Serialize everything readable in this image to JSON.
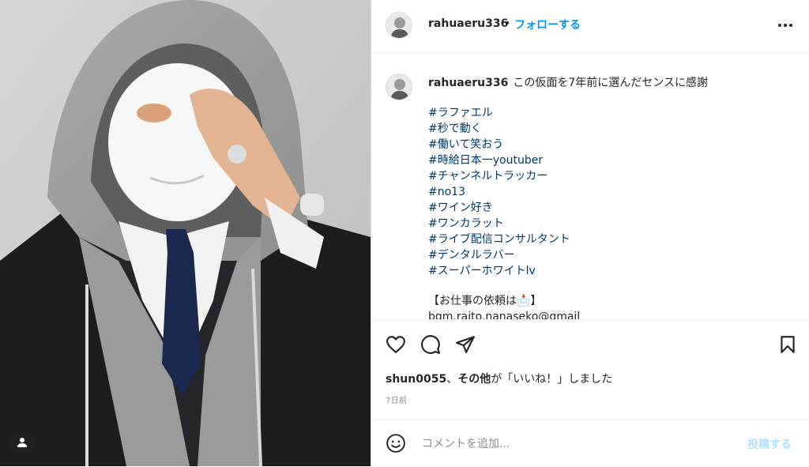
{
  "post": {
    "username": "rahuaeru336",
    "separator": "•",
    "follow_label": "フォローする",
    "more_icon": "more-horizontal-icon",
    "photo_user_tag_icon": "person-icon"
  },
  "caption": {
    "username": "rahuaeru336",
    "text": "この仮面を7年前に選んだセンスに感謝",
    "hashtags": [
      "#ラファエル",
      "#秒で動く",
      "#働いて笑おう",
      "#時給日本一youtuber",
      "#チャンネルトラッカー",
      "#no13",
      "#ワイン好き",
      "#ワンカラット",
      "#ライブ配信コンサルタント",
      "#デンタルラバー",
      "#スーパーホワイトlv"
    ],
    "contact_heading": "【お仕事の依頼は📩】",
    "contact_email": "bgm.raito.nanaseko@gmail"
  },
  "actions": {
    "like_icon": "heart-icon",
    "comment_icon": "comment-icon",
    "share_icon": "share-plane-icon",
    "save_icon": "bookmark-icon"
  },
  "likes": {
    "user": "shun0055",
    "separator": "、",
    "others": "その他",
    "suffix": "が「いいね！」しました"
  },
  "timestamp": "7日前",
  "comment": {
    "emoji_icon": "smiley-icon",
    "placeholder": "コメントを追加...",
    "post_label": "投稿する"
  },
  "colors": {
    "link_blue": "#0095f6",
    "hashtag": "#00376b",
    "post_disabled": "#b2dffc"
  }
}
